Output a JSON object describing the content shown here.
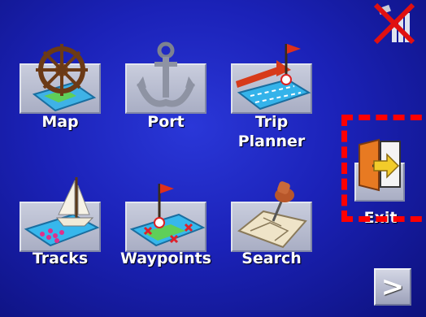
{
  "menu": {
    "items": [
      {
        "id": "map",
        "label": "Map",
        "icon": "ship-wheel-map-icon"
      },
      {
        "id": "port",
        "label": "Port",
        "icon": "anchor-icon"
      },
      {
        "id": "trip",
        "label": "Trip\nPlanner",
        "icon": "trip-planner-icon"
      },
      {
        "id": "tracks",
        "label": "Tracks",
        "icon": "sailboat-tracks-icon"
      },
      {
        "id": "waypoints",
        "label": "Waypoints",
        "icon": "waypoints-icon"
      },
      {
        "id": "search",
        "label": "Search",
        "icon": "search-pushpin-icon"
      }
    ],
    "exit": {
      "label": "Exit",
      "icon": "exit-door-icon"
    },
    "next": {
      "label": ">",
      "icon": "next-arrow-icon"
    }
  },
  "status": {
    "gps_icon": "no-satellite-signal-icon"
  },
  "colors": {
    "background": "#1b22b8",
    "highlight": "#ff0000",
    "label": "#ffffff"
  }
}
